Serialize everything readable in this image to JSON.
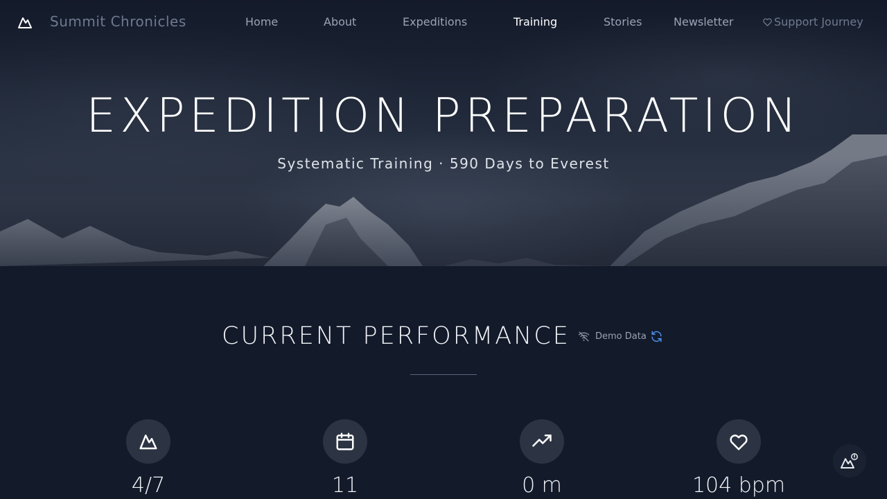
{
  "brand": {
    "name": "Summit Chronicles",
    "logo_icon": "mountain-icon"
  },
  "nav": {
    "items": [
      {
        "label": "Home",
        "active": false
      },
      {
        "label": "About",
        "active": false
      },
      {
        "label": "Expeditions",
        "active": false
      },
      {
        "label": "Training",
        "active": true
      },
      {
        "label": "Stories",
        "active": false
      },
      {
        "label": "Newsletter",
        "active": false
      }
    ],
    "support": {
      "label": "Support Journey",
      "icon": "heart-icon"
    }
  },
  "hero": {
    "title": "EXPEDITION PREPARATION",
    "subtitle": "Systematic Training · 590 Days to Everest"
  },
  "performance": {
    "title": "CURRENT PERFORMANCE",
    "status_label": "Demo Data",
    "status_icon": "wifi-off-icon",
    "refresh_icon": "refresh-icon",
    "stats": [
      {
        "icon": "mountain-icon",
        "value": "4/7"
      },
      {
        "icon": "calendar-icon",
        "value": "11"
      },
      {
        "icon": "trending-up-icon",
        "value": "0 m"
      },
      {
        "icon": "heart-icon",
        "value": "104 bpm"
      }
    ]
  },
  "fab": {
    "icon": "mountain-flag-icon"
  },
  "colors": {
    "background": "#131a2a",
    "nav_active": "#ffffff",
    "nav_inactive": "#9aa4b6",
    "accent_refresh": "#4a8fe8",
    "stat_circle": "#2c3443"
  }
}
